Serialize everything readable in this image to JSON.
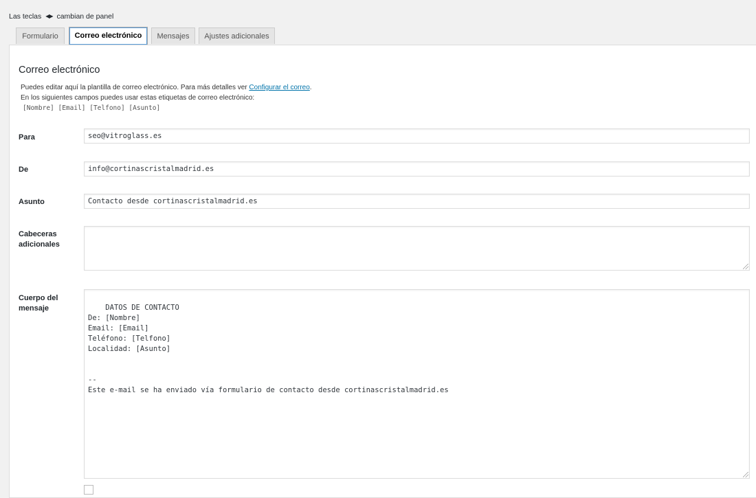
{
  "hint": {
    "prefix": "Las teclas",
    "arrows": "◀▶",
    "suffix": "cambian de panel"
  },
  "tabs": [
    {
      "label": "Formulario",
      "active": false
    },
    {
      "label": "Correo electrónico",
      "active": true
    },
    {
      "label": "Mensajes",
      "active": false
    },
    {
      "label": "Ajustes adicionales",
      "active": false
    }
  ],
  "section": {
    "title": "Correo electrónico",
    "desc1_prefix": "Puedes editar aquí la plantilla de correo electrónico. Para más detalles ver ",
    "desc1_link": "Configurar el correo",
    "desc1_suffix": ".",
    "desc2": "En los siguientes campos puedes usar estas etiquetas de correo electrónico:",
    "tags": "[Nombre] [Email] [Telfono] [Asunto]"
  },
  "fields": {
    "to": {
      "label": "Para",
      "value": "seo@vitroglass.es"
    },
    "from": {
      "label": "De",
      "value": "info@cortinascristalmadrid.es"
    },
    "subject": {
      "label": "Asunto",
      "value": "Contacto desde cortinascristalmadrid.es"
    },
    "headers": {
      "label": "Cabeceras adicionales",
      "value": ""
    },
    "body": {
      "label": "Cuerpo del mensaje",
      "value": "DATOS DE CONTACTO\nDe: [Nombre]\nEmail: [Email]\nTeléfono: [Telfono]\nLocalidad: [Asunto]\n\n\n--\nEste e-mail se ha enviado vía formulario de contacto desde cortinascristalmadrid.es"
    }
  }
}
